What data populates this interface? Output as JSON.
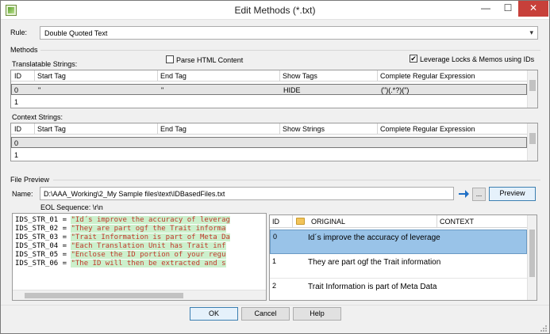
{
  "window": {
    "title": "Edit Methods (*.txt)",
    "min": "—",
    "max": "☐",
    "close": "✕"
  },
  "rule": {
    "label": "Rule:",
    "value": "Double Quoted Text"
  },
  "methods": {
    "group_title": "Methods",
    "translatable_label": "Translatable Strings:",
    "parse_html_label": "Parse HTML Content",
    "parse_html_checked": false,
    "leverage_label": "Leverage Locks & Memos using IDs",
    "leverage_checked": true,
    "translatable_columns": [
      "ID",
      "Start Tag",
      "End Tag",
      "Show Tags",
      "Complete Regular Expression"
    ],
    "translatable_rows": [
      {
        "id": "0",
        "start": "\"",
        "end": "\"",
        "show": "HIDE",
        "regex": "(\")(.*?)(\")"
      },
      {
        "id": "1",
        "start": "",
        "end": "",
        "show": "",
        "regex": ""
      }
    ],
    "context_label": "Context Strings:",
    "context_columns": [
      "ID",
      "Start Tag",
      "End Tag",
      "Show Strings",
      "Complete Regular Expression"
    ],
    "context_rows": [
      {
        "id": "0"
      },
      {
        "id": "1"
      }
    ]
  },
  "preview": {
    "group_title": "File Preview",
    "name_label": "Name:",
    "file_path": "D:\\AAA_Working\\2_My Sample files\\text\\IDBasedFiles.txt",
    "browse_label": "...",
    "preview_button": "Preview",
    "eol_label": "EOL Sequence: \\r\\n",
    "source_lines": [
      {
        "id": "IDS_STR_01",
        "text": "\"Id´s improve the accuracy of leverag"
      },
      {
        "id": "IDS_STR_02",
        "text": "\"They are part ogf the Trait informa"
      },
      {
        "id": "IDS_STR_03",
        "text": "\"Trait Information is part of Meta Da"
      },
      {
        "id": "IDS_STR_04",
        "text": "\"Each Translation Unit has Trait inf"
      },
      {
        "id": "IDS_STR_05",
        "text": "\"Enclose the ID portion of your regu"
      },
      {
        "id": "IDS_STR_06",
        "text": "\"The ID will then be extracted and s"
      }
    ],
    "table_columns": {
      "id": "ID",
      "original": "ORIGINAL",
      "context": "CONTEXT"
    },
    "table_rows": [
      {
        "id": "0",
        "original": "Id´s improve the accuracy of leverage"
      },
      {
        "id": "1",
        "original": "They are part ogf the Trait information"
      },
      {
        "id": "2",
        "original": "Trait Information is part of Meta Data"
      }
    ]
  },
  "buttons": {
    "ok": "OK",
    "cancel": "Cancel",
    "help": "Help"
  },
  "colors": {
    "accent": "#0078d7",
    "selection": "#99c3e8",
    "string_bg": "#ccf0cc",
    "string_fg": "#c0392b",
    "close_button": "#c7403a"
  }
}
